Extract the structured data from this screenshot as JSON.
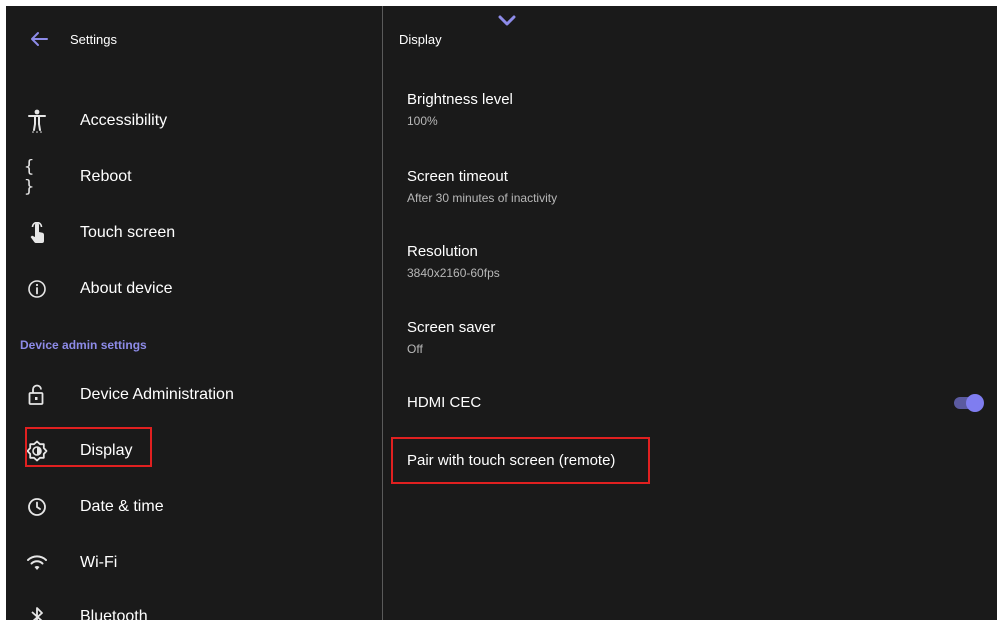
{
  "left": {
    "header": {
      "title": "Settings"
    },
    "items": [
      {
        "label": "Accessibility",
        "icon": "accessibility-icon"
      },
      {
        "label": "Reboot",
        "icon": "braces-icon"
      },
      {
        "label": "Touch screen",
        "icon": "touch-icon"
      },
      {
        "label": "About device",
        "icon": "info-icon"
      }
    ],
    "section_label": "Device admin settings",
    "admin_items": [
      {
        "label": "Device Administration",
        "icon": "lock-open-icon"
      },
      {
        "label": "Display",
        "icon": "brightness-icon",
        "selected": true
      },
      {
        "label": "Date & time",
        "icon": "clock-icon"
      },
      {
        "label": "Wi-Fi",
        "icon": "wifi-icon"
      },
      {
        "label": "Bluetooth",
        "icon": "bluetooth-icon"
      }
    ]
  },
  "right": {
    "header": {
      "title": "Display"
    },
    "settings": [
      {
        "title": "Brightness level",
        "subtitle": "100%"
      },
      {
        "title": "Screen timeout",
        "subtitle": "After 30 minutes of inactivity"
      },
      {
        "title": "Resolution",
        "subtitle": "3840x2160-60fps"
      },
      {
        "title": "Screen saver",
        "subtitle": "Off"
      }
    ],
    "hdmi": {
      "title": "HDMI CEC",
      "enabled": true
    },
    "pair": {
      "title": "Pair with touch screen (remote)"
    }
  },
  "colors": {
    "background": "#1a1a1a",
    "accent": "#7f7df0",
    "section_label": "#8d8be8",
    "highlight": "#e02020"
  }
}
